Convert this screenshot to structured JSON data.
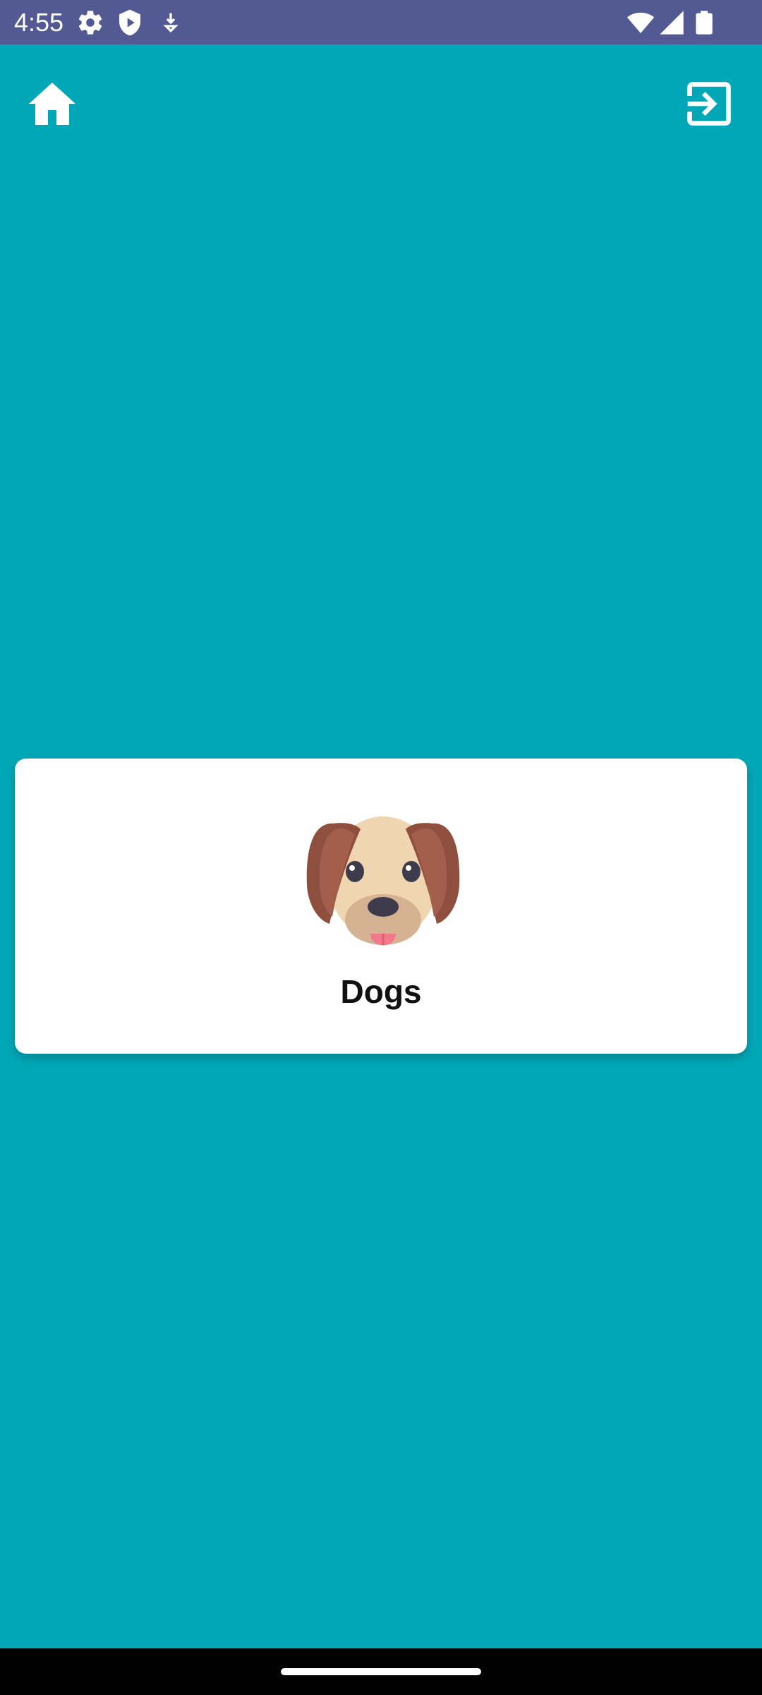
{
  "status_bar": {
    "time": "4:55",
    "icons": [
      "settings-icon",
      "shield-play-icon",
      "download-icon",
      "wifi-icon",
      "signal-icon",
      "battery-icon"
    ],
    "background": "#535A93"
  },
  "app_bar": {
    "left_icon": "home-icon",
    "right_icon": "exit-icon"
  },
  "card": {
    "image": "dog-icon",
    "label": "Dogs"
  },
  "colors": {
    "background": "#00A8B7",
    "card": "#FFFFFF",
    "text": "#111111"
  }
}
